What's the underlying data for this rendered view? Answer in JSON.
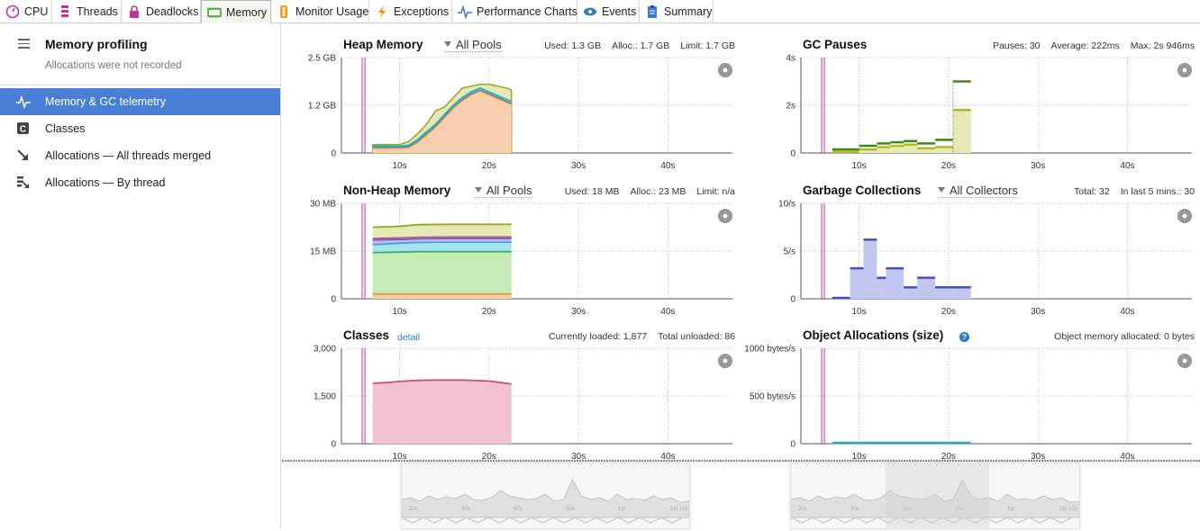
{
  "tabs": [
    {
      "label": "CPU",
      "icon": "cpu-icon",
      "active": false
    },
    {
      "label": "Threads",
      "icon": "threads-icon",
      "active": false
    },
    {
      "label": "Deadlocks",
      "icon": "lock-icon",
      "active": false
    },
    {
      "label": "Memory",
      "icon": "memory-icon",
      "active": true
    },
    {
      "label": "Monitor Usage",
      "icon": "traffic-light-icon",
      "active": false
    },
    {
      "label": "Exceptions",
      "icon": "lightning-icon",
      "active": false
    },
    {
      "label": "Performance Charts",
      "icon": "pulse-icon",
      "active": false
    },
    {
      "label": "Events",
      "icon": "eye-icon",
      "active": false
    },
    {
      "label": "Summary",
      "icon": "clipboard-icon",
      "active": false
    }
  ],
  "sidebar": {
    "title": "Memory profiling",
    "subtitle": "Allocations were not recorded",
    "items": [
      {
        "label": "Memory & GC telemetry",
        "icon": "pulse-icon",
        "active": true
      },
      {
        "label": "Classes",
        "icon": "class-c-icon",
        "active": false
      },
      {
        "label": "Allocations — All threads merged",
        "icon": "arrow-down-right-icon",
        "active": false
      },
      {
        "label": "Allocations — By thread",
        "icon": "thread-list-icon",
        "active": false
      }
    ]
  },
  "colors": {
    "accent": "#4a7fd8",
    "marker": "#c0359a"
  },
  "panels": {
    "heap": {
      "title": "Heap Memory",
      "selector": "All Pools",
      "stats": [
        "Used: 1.3 GB",
        "Alloc.: 1.7 GB",
        "Limit: 1.7 GB"
      ],
      "yticks": [
        "2.5 GB",
        "1.2 GB",
        "0"
      ],
      "xticks": [
        "10s",
        "20s",
        "30s",
        "40s"
      ]
    },
    "gc_pauses": {
      "title": "GC Pauses",
      "stats": [
        "Pauses: 30",
        "Average: 222ms",
        "Max: 2s 946ms"
      ],
      "yticks": [
        "4s",
        "2s",
        "0"
      ],
      "xticks": [
        "10s",
        "20s",
        "30s",
        "40s"
      ]
    },
    "nonheap": {
      "title": "Non-Heap Memory",
      "selector": "All Pools",
      "stats": [
        "Used: 18 MB",
        "Alloc.: 23 MB",
        "Limit: n/a"
      ],
      "yticks": [
        "30 MB",
        "15 MB",
        "0"
      ],
      "xticks": [
        "10s",
        "20s",
        "30s",
        "40s"
      ]
    },
    "gc": {
      "title": "Garbage Collections",
      "selector": "All Collectors",
      "stats": [
        "Total: 32",
        "In last 5 mins.: 30"
      ],
      "yticks": [
        "10/s",
        "5/s",
        "0"
      ],
      "xticks": [
        "10s",
        "20s",
        "30s",
        "40s"
      ]
    },
    "classes": {
      "title": "Classes",
      "link": "detail",
      "stats": [
        "Currently loaded: 1,877",
        "Total unloaded: 86"
      ],
      "yticks": [
        "3,000",
        "1,500",
        "0"
      ],
      "xticks": [
        "10s",
        "20s",
        "30s",
        "40s"
      ]
    },
    "alloc": {
      "title": "Object Allocations (size)",
      "stats": [
        "Object memory allocated: 0 bytes"
      ],
      "yticks": [
        "1000 bytes/s",
        "500 bytes/s",
        "0"
      ],
      "xticks": [
        "10s",
        "20s",
        "30s",
        "40s"
      ]
    }
  },
  "overview": {
    "left_ticks": [
      "20s",
      "30s",
      "40s",
      "50s",
      "1m",
      "1m 10s"
    ],
    "right_ticks": [
      "20s",
      "30s",
      "40s",
      "50s",
      "1m",
      "1m 10s"
    ]
  },
  "chart_data": [
    {
      "type": "area",
      "title": "Heap Memory",
      "ylim": [
        0,
        2.5
      ],
      "unit": "GB",
      "x": [
        7,
        8,
        9,
        10,
        11,
        12,
        13,
        14,
        15,
        16,
        17,
        18,
        19,
        20,
        21,
        22,
        22.5
      ],
      "series": [
        {
          "values": [
            0.18,
            0.18,
            0.18,
            0.18,
            0.2,
            0.35,
            0.55,
            0.75,
            1.0,
            1.25,
            1.45,
            1.6,
            1.7,
            1.6,
            1.5,
            1.4,
            1.35
          ]
        },
        {
          "values": [
            0.15,
            0.15,
            0.15,
            0.15,
            0.17,
            0.3,
            0.5,
            0.7,
            0.95,
            1.2,
            1.4,
            1.55,
            1.65,
            1.55,
            1.45,
            1.35,
            1.3
          ]
        },
        {
          "values": [
            0.22,
            0.22,
            0.22,
            0.22,
            0.3,
            0.5,
            0.75,
            1.1,
            1.2,
            1.45,
            1.7,
            1.75,
            1.8,
            1.8,
            1.75,
            1.7,
            1.65
          ]
        }
      ]
    },
    {
      "type": "bar",
      "title": "GC Pauses",
      "ylim": [
        0,
        4
      ],
      "unit": "s",
      "x": [
        7,
        10,
        12,
        13.5,
        15,
        16.5,
        18.5,
        20.5
      ],
      "values": [
        0.05,
        0.15,
        0.25,
        0.3,
        0.35,
        0.2,
        0.25,
        1.8
      ],
      "max_line": [
        0.15,
        0.3,
        0.4,
        0.45,
        0.5,
        0.4,
        0.55,
        3.0
      ]
    },
    {
      "type": "area",
      "title": "Non-Heap Memory",
      "ylim": [
        0,
        30
      ],
      "unit": "MB",
      "x": [
        7,
        10,
        12,
        15,
        20,
        22.5
      ],
      "series": [
        {
          "values": [
            1.5,
            1.5,
            1.5,
            1.5,
            1.5,
            1.5
          ]
        },
        {
          "values": [
            14.5,
            14.7,
            14.8,
            14.8,
            14.8,
            14.8
          ]
        },
        {
          "values": [
            17,
            17.5,
            17.7,
            17.8,
            17.8,
            17.8
          ]
        },
        {
          "values": [
            18.5,
            18.7,
            18.9,
            19,
            19,
            19
          ]
        },
        {
          "values": [
            22.5,
            22.8,
            23.3,
            23.4,
            23.4,
            23.4
          ]
        }
      ]
    },
    {
      "type": "bar",
      "title": "Garbage Collections",
      "ylim": [
        0,
        10
      ],
      "unit": "/s",
      "x": [
        7,
        9,
        10.5,
        12,
        13,
        15,
        16.5,
        18.5,
        20.5
      ],
      "values": [
        0.1,
        3.2,
        6.2,
        2.2,
        3.2,
        1.2,
        2.2,
        1.2,
        1.2
      ]
    },
    {
      "type": "area",
      "title": "Classes",
      "ylim": [
        0,
        3000
      ],
      "x": [
        7,
        9,
        10,
        12,
        14,
        17,
        20,
        22.5
      ],
      "values": [
        1900,
        1930,
        1960,
        1990,
        2000,
        2000,
        1970,
        1877
      ]
    },
    {
      "type": "line",
      "title": "Object Allocations (size)",
      "ylim": [
        0,
        1000
      ],
      "unit": "bytes/s",
      "x": [
        7,
        22.5
      ],
      "values": [
        0,
        0
      ]
    }
  ]
}
